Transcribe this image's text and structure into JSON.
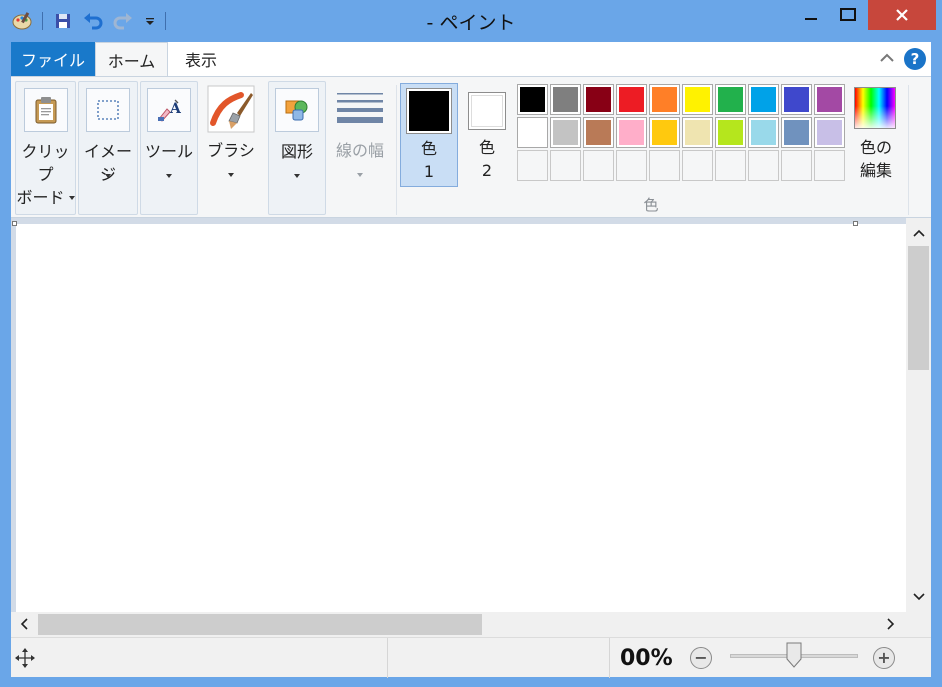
{
  "window": {
    "title": "- ペイント",
    "colors": {
      "frame": "#6aa6e8",
      "close": "#c7473c",
      "file_tab": "#1979ca",
      "accent": "#1a74c8"
    }
  },
  "quick_access": {
    "items": [
      {
        "icon": "paint-app-icon"
      },
      {
        "icon": "save-icon"
      },
      {
        "icon": "undo-icon"
      },
      {
        "icon": "redo-icon"
      },
      {
        "icon": "customize-dropdown-icon"
      }
    ]
  },
  "tabs": [
    {
      "label": "ファイル"
    },
    {
      "label": "ホーム"
    },
    {
      "label": "表示"
    }
  ],
  "help": {
    "label": "?"
  },
  "ribbon": {
    "clipboard": {
      "line1": "クリップ",
      "line2": "ボード",
      "icon": "clipboard-icon"
    },
    "image": {
      "label": "イメージ",
      "icon": "select-icon"
    },
    "tools": {
      "label": "ツール",
      "icon": "tools-icon"
    },
    "brushes": {
      "label": "ブラシ",
      "icon": "brush-icon"
    },
    "shapes": {
      "label": "図形",
      "icon": "shapes-icon"
    },
    "size": {
      "label": "線の幅",
      "icon": "line-width-icon"
    },
    "color1": {
      "line1": "色",
      "line2": "1",
      "value": "#000000"
    },
    "color2": {
      "line1": "色",
      "line2": "2",
      "value": "#ffffff"
    },
    "colors_group_title": "色",
    "edit_colors": {
      "line1": "色の",
      "line2": "編集",
      "icon": "color-spectrum-icon"
    },
    "palette": {
      "row1": [
        "#000000",
        "#7f7f7f",
        "#880015",
        "#ed1c24",
        "#ff7f27",
        "#fff200",
        "#22b14c",
        "#00a2e8",
        "#3f48cc",
        "#a349a4"
      ],
      "row2": [
        "#ffffff",
        "#c3c3c3",
        "#b97a57",
        "#ffaec9",
        "#ffc90e",
        "#efe4b0",
        "#b5e61d",
        "#99d9ea",
        "#7092be",
        "#c8bfe7"
      ],
      "row3_empty": 10
    }
  },
  "status": {
    "zoom": "00%",
    "zoom_out": "−",
    "zoom_in": "+",
    "zoom_level": 0.5,
    "icon": "move-cursor-icon"
  }
}
